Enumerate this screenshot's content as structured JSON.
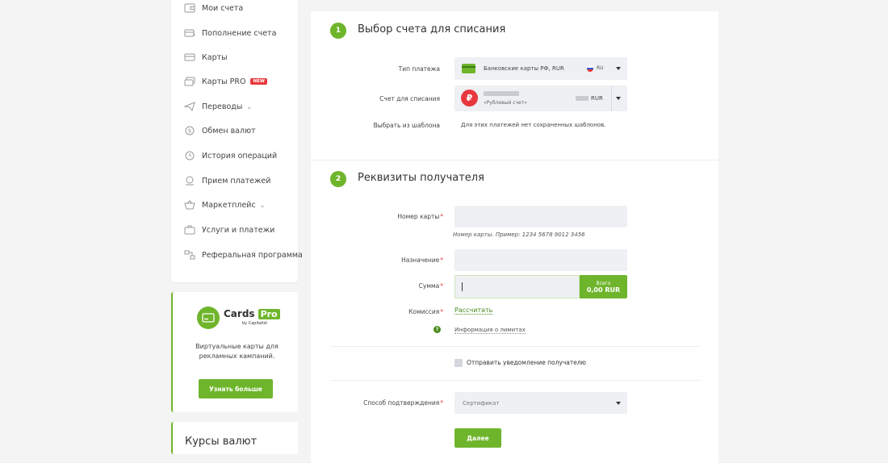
{
  "colors": {
    "accent": "#6fb52c",
    "danger": "#e8383d",
    "field_bg": "#eef0f4"
  },
  "sidebar": {
    "items": [
      {
        "label": "Мои счета",
        "icon": "wallet-icon"
      },
      {
        "label": "Пополнение счета",
        "icon": "card-plus-icon"
      },
      {
        "label": "Карты",
        "icon": "card-icon"
      },
      {
        "label": "Карты PRO",
        "icon": "cards-pro-icon",
        "badge": "NEW"
      },
      {
        "label": "Переводы",
        "icon": "send-icon",
        "expandable": true
      },
      {
        "label": "Обмен валют",
        "icon": "exchange-icon"
      },
      {
        "label": "История операций",
        "icon": "history-icon"
      },
      {
        "label": "Прием платежей",
        "icon": "receive-payments-icon"
      },
      {
        "label": "Маркетплейс",
        "icon": "basket-icon",
        "expandable": true
      },
      {
        "label": "Услуги и платежи",
        "icon": "services-icon"
      },
      {
        "label": "Реферальная программа",
        "icon": "referral-icon"
      }
    ]
  },
  "promo": {
    "brand": "Cards",
    "brand_pro": "Pro",
    "by": "by Capitalist",
    "text": "Виртуальные карты для рекламных кампаний.",
    "button": "Узнать больше"
  },
  "rates": {
    "title": "Курсы валют"
  },
  "section1": {
    "number": "1",
    "title": "Выбор счета для списания",
    "payment_type_label": "Тип платежа",
    "payment_type_value": "Банковские карты РФ, RUR",
    "payment_type_flag": "RU",
    "account_label": "Счет для списания",
    "account_name": "«Рублевый счет»",
    "account_currency": "RUR",
    "template_label": "Выбрать из шаблона",
    "template_value": "Для этих платежей нет сохраненных шаблонов."
  },
  "section2": {
    "number": "2",
    "title": "Реквизиты получателя",
    "card_number_label": "Номер карты",
    "card_number_hint": "Номер карты. Пример: 1234 5678 9012 3456",
    "purpose_label": "Назначение",
    "amount_label": "Сумма",
    "total_label": "Всего",
    "total_value": "0,00",
    "total_currency": "RUR",
    "commission_label": "Комиссия",
    "commission_link": "Рассчитать",
    "limits_link": "Информация о лимитах",
    "notify_label": "Отправить уведомление получателю",
    "confirm_label": "Способ подтверждения",
    "confirm_value": "Сертификат",
    "next_button": "Далее"
  }
}
